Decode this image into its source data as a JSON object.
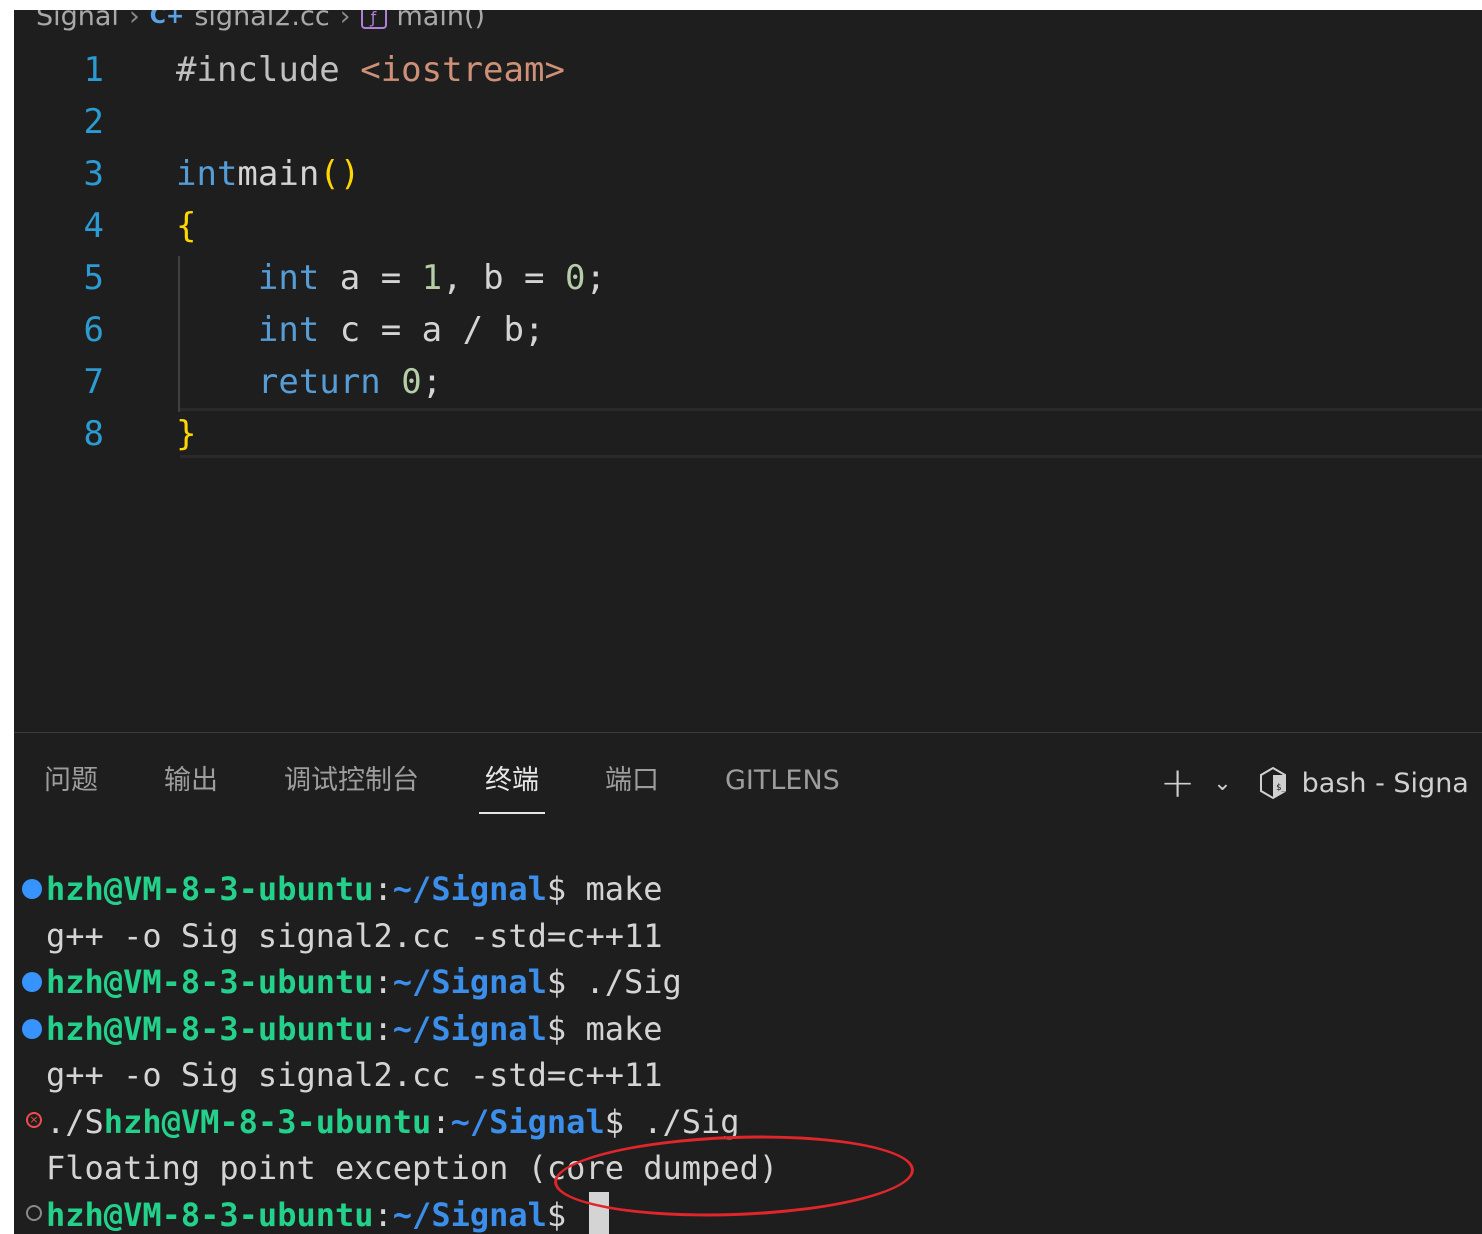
{
  "breadcrumb": {
    "folder": "Signal",
    "file": "signal2.cc",
    "symbol": "main()"
  },
  "editor": {
    "lines": [
      {
        "n": "1",
        "tokens": [
          [
            "pp",
            "#include "
          ],
          [
            "str",
            "<iostream>"
          ]
        ]
      },
      {
        "n": "2",
        "tokens": []
      },
      {
        "n": "3",
        "tokens": [
          [
            "kw",
            "int"
          ],
          [
            "",
            "main"
          ],
          [
            "br",
            "()"
          ]
        ]
      },
      {
        "n": "4",
        "tokens": [
          [
            "br",
            "{"
          ]
        ]
      },
      {
        "n": "5",
        "tokens": [
          [
            "",
            "    "
          ],
          [
            "kw",
            "int"
          ],
          [
            "",
            " a = "
          ],
          [
            "num",
            "1"
          ],
          [
            "",
            ", b = "
          ],
          [
            "num",
            "0"
          ],
          [
            "",
            ";"
          ]
        ]
      },
      {
        "n": "6",
        "tokens": [
          [
            "",
            "    "
          ],
          [
            "kw",
            "int"
          ],
          [
            "",
            " c = a / b;"
          ]
        ]
      },
      {
        "n": "7",
        "tokens": [
          [
            "",
            "    "
          ],
          [
            "kw",
            "return"
          ],
          [
            "",
            " "
          ],
          [
            "num",
            "0"
          ],
          [
            "",
            ";"
          ]
        ]
      },
      {
        "n": "8",
        "tokens": [
          [
            "br",
            "}"
          ]
        ]
      }
    ]
  },
  "panel": {
    "tabs": [
      "问题",
      "输出",
      "调试控制台",
      "终端",
      "端口",
      "GITLENS"
    ],
    "active_tab": "终端",
    "terminal_name": "bash - Signa"
  },
  "terminal": {
    "user": "hzh@VM-8-3-ubuntu",
    "path": "~/Signal",
    "lines": [
      {
        "status": "ok",
        "prefix": "",
        "prompt": true,
        "cmd": "$ make"
      },
      {
        "status": "none",
        "text": "g++ -o Sig signal2.cc -std=c++11"
      },
      {
        "status": "ok",
        "prefix": "",
        "prompt": true,
        "cmd": "$ ./Sig"
      },
      {
        "status": "ok",
        "prefix": "",
        "prompt": true,
        "cmd": "$ make"
      },
      {
        "status": "none",
        "text": "g++ -o Sig signal2.cc -std=c++11"
      },
      {
        "status": "err",
        "prefix": "./S",
        "prompt": true,
        "cmd": "$ ./Sig"
      },
      {
        "status": "none",
        "text": "Floating point exception (core dumped)"
      },
      {
        "status": "idle",
        "prefix": "",
        "prompt": true,
        "cmd": "$ ",
        "cursor": true
      }
    ]
  },
  "colors": {
    "background": "#1e1e1e",
    "prompt_user": "#23d18b",
    "prompt_path": "#3b8eea",
    "annotation": "#e0262a"
  }
}
